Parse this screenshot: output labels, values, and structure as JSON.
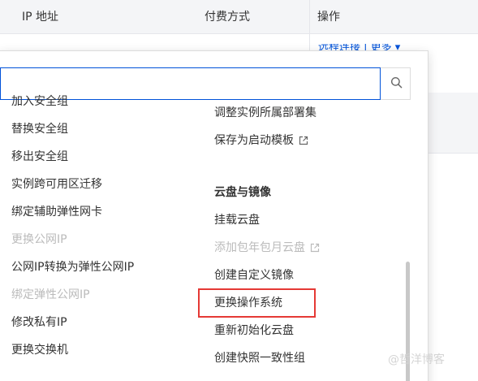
{
  "table": {
    "headers": [
      "IP 地址",
      "付费方式",
      "操作"
    ],
    "partial_link": "远程连接 | 更多 ▾"
  },
  "search": {
    "value": "",
    "placeholder": ""
  },
  "menu": {
    "left": [
      {
        "label": "加入安全组",
        "disabled": false
      },
      {
        "label": "替换安全组",
        "disabled": false
      },
      {
        "label": "移出安全组",
        "disabled": false
      },
      {
        "label": "实例跨可用区迁移",
        "disabled": false
      },
      {
        "label": "绑定辅助弹性网卡",
        "disabled": false
      },
      {
        "label": "更换公网IP",
        "disabled": true
      },
      {
        "label": "公网IP转换为弹性公网IP",
        "disabled": false
      },
      {
        "label": "绑定弹性公网IP",
        "disabled": true
      },
      {
        "label": "修改私有IP",
        "disabled": false
      },
      {
        "label": "更换交换机",
        "disabled": false
      }
    ],
    "right": [
      {
        "label": "调整实例所属部署集",
        "disabled": false
      },
      {
        "label": "保存为启动模板",
        "disabled": false,
        "external": true
      },
      {
        "label": "云盘与镜像",
        "group": true
      },
      {
        "label": "挂载云盘",
        "disabled": false
      },
      {
        "label": "添加包年包月云盘",
        "disabled": true,
        "external": true
      },
      {
        "label": "创建自定义镜像",
        "disabled": false
      },
      {
        "label": "更换操作系统",
        "disabled": false,
        "highlighted": true
      },
      {
        "label": "重新初始化云盘",
        "disabled": false
      },
      {
        "label": "创建快照一致性组",
        "disabled": false
      }
    ]
  },
  "watermark": "@哲洋博客",
  "colors": {
    "accent": "#0052d9",
    "highlight": "#e53935",
    "disabled_text": "#bbbbbb",
    "text": "#333333"
  },
  "icons": {
    "search": "search-icon",
    "external": "external-link-icon"
  }
}
